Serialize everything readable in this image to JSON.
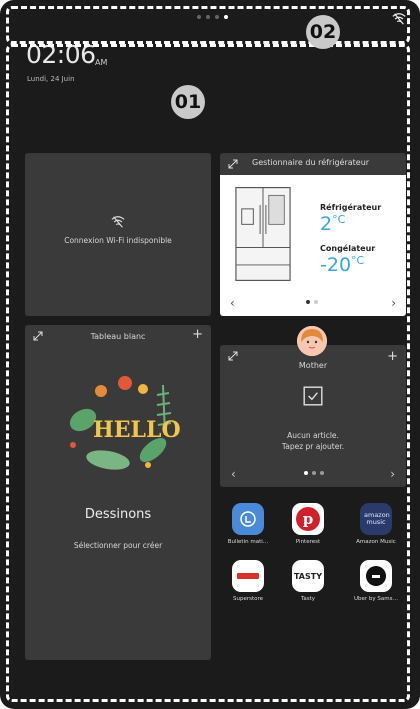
{
  "status": {
    "time": "02:06",
    "ampm": "AM",
    "date": "Lundi, 24 Juin",
    "page_count": 4,
    "active_page": 3
  },
  "badges": {
    "zone_main": "01",
    "zone_top": "02"
  },
  "wifi_card": {
    "message": "Connexion Wi-Fi indisponible",
    "icon": "wifi-off-icon"
  },
  "fridge": {
    "title": "Gestionnaire du réfrigérateur",
    "fridge_label": "Réfrigérateur",
    "fridge_temp": "2",
    "freezer_label": "Congélateur",
    "freezer_temp": "-20",
    "unit": "°C"
  },
  "whiteboard": {
    "title": "Tableau blanc",
    "art_text": "HELLO",
    "heading": "Dessinons",
    "subtitle": "Sélectionner pour créer"
  },
  "memo": {
    "user": "Mother",
    "line1": "Aucun article.",
    "line2": "Tapez pr ajouter."
  },
  "apps": [
    {
      "label": "Bulletin mati…",
      "icon": "bulletin-icon",
      "color": "#4a8ad6"
    },
    {
      "label": "Pinterest",
      "icon": "pinterest-icon",
      "color": "#ffffff"
    },
    {
      "label": "Amazon Music",
      "icon": "amazon-music-icon",
      "color": "#2a3a6b",
      "text": "amazon music"
    },
    {
      "label": "Superstore",
      "icon": "superstore-icon",
      "color": "#ffffff"
    },
    {
      "label": "Tasty",
      "icon": "tasty-icon",
      "color": "#ffffff",
      "text": "TASTY"
    },
    {
      "label": "Uber by Sams…",
      "icon": "uber-icon",
      "color": "#ffffff"
    }
  ]
}
